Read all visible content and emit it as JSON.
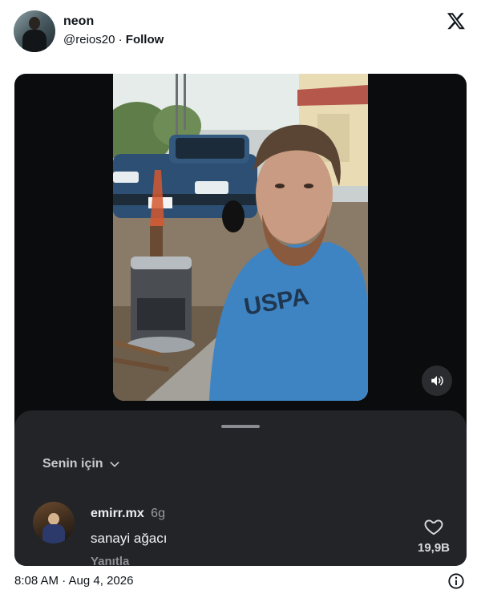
{
  "author": {
    "name": "neon",
    "handle": "@reios20",
    "separator": "·",
    "follow_label": "Follow"
  },
  "platform_icon": "x-logo-icon",
  "video": {
    "description_icon": "selfie-video-frame",
    "sound_icon": "speaker-icon"
  },
  "sheet": {
    "filter_label": "Senin için",
    "filter_icon": "chevron-down-icon",
    "comment": {
      "username": "emirr.mx",
      "age": "6g",
      "text": "sanayi ağacı",
      "reply_label": "Yanıtla",
      "like_icon": "heart-icon",
      "like_count": "19,9B"
    }
  },
  "footer": {
    "timestamp": "8:08 AM · Aug 4, 2026",
    "info_icon": "info-icon"
  },
  "colors": {
    "card_bg": "#0b0c0e",
    "sheet_bg": "#232428",
    "text_primary": "#0f1419"
  }
}
